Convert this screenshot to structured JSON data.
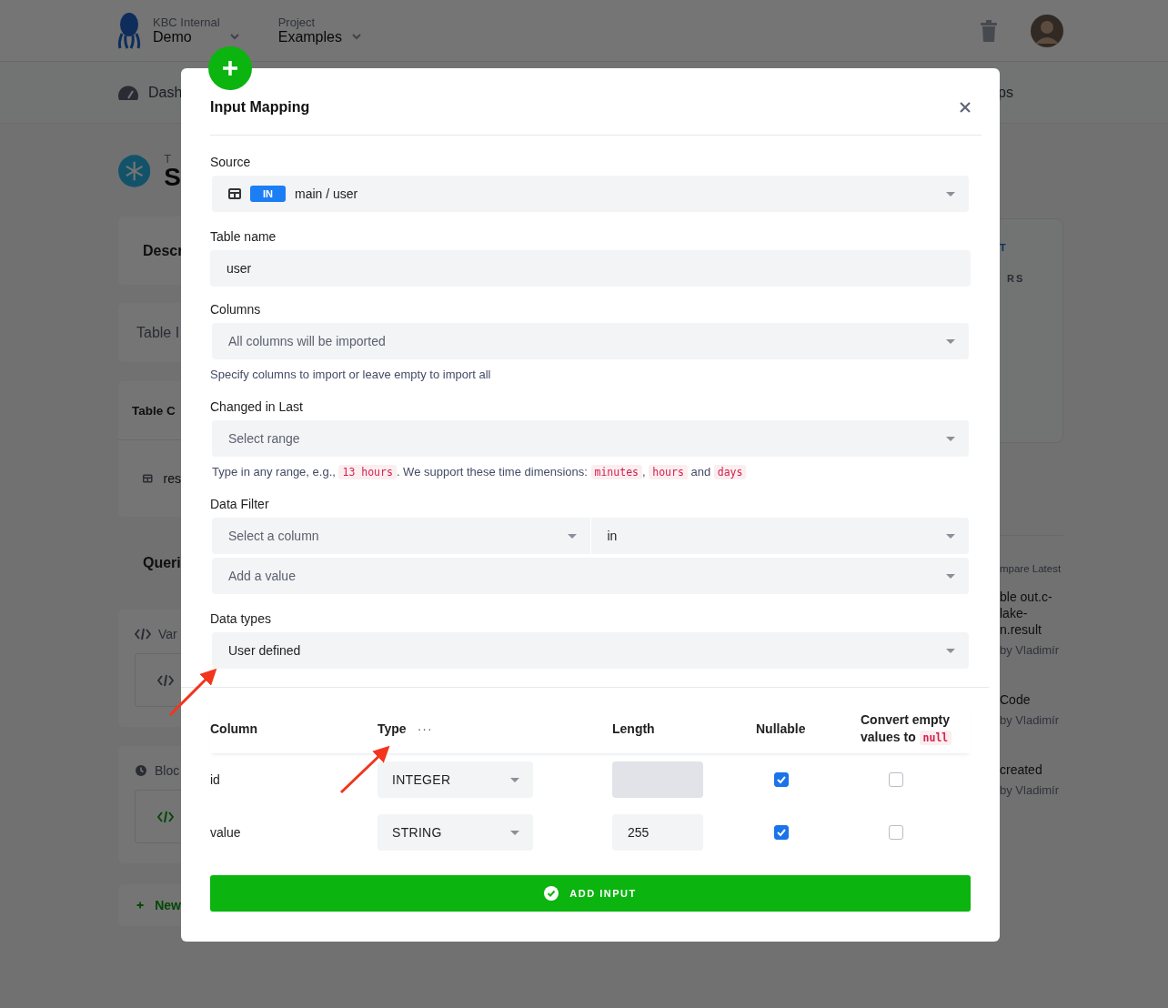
{
  "background_app": {
    "header": {
      "org_label": "KBC Internal",
      "org": "Demo",
      "project_label": "Project",
      "project": "Examples"
    },
    "nav": {
      "left": "Dash",
      "right": "ps"
    },
    "title": {
      "small": "T",
      "large": "S"
    },
    "left_fragments": [
      {
        "kind": "card-title",
        "text": "Descr"
      },
      {
        "kind": "card-muted",
        "text": "Table I"
      },
      {
        "kind": "card-table",
        "text": "Table C",
        "item": "res"
      },
      {
        "kind": "heading",
        "text": "Queri"
      },
      {
        "kind": "code-card",
        "text": "Var"
      },
      {
        "kind": "block-card",
        "text": "Bloc"
      },
      {
        "kind": "new",
        "text": "New"
      }
    ],
    "right_fragments": {
      "card_lines": [
        "T",
        "RS"
      ],
      "caption": "mpare Latest",
      "events": [
        {
          "lines": [
            "ble out.c-",
            "lake-",
            "n.result"
          ],
          "meta": "by Vladimír"
        },
        {
          "lines": [
            "Code"
          ],
          "meta": "by Vladimír"
        },
        {
          "lines": [
            "created"
          ],
          "meta": "by Vladimír"
        }
      ]
    }
  },
  "modal": {
    "title": "Input Mapping",
    "source": {
      "label": "Source",
      "badge": "IN",
      "value": "main / user"
    },
    "table_name": {
      "label": "Table name",
      "value": "user"
    },
    "columns": {
      "label": "Columns",
      "placeholder": "All columns will be imported",
      "help": "Specify columns to import or leave empty to import all"
    },
    "changed_in_last": {
      "label": "Changed in Last",
      "placeholder": "Select range",
      "help": [
        {
          "kind": "text",
          "text": "Type in any range, e.g., "
        },
        {
          "kind": "code",
          "text": "13 hours"
        },
        {
          "kind": "text",
          "text": ". We support these time dimensions: "
        },
        {
          "kind": "code",
          "text": "minutes"
        },
        {
          "kind": "text",
          "text": ", "
        },
        {
          "kind": "code",
          "text": "hours"
        },
        {
          "kind": "text",
          "text": " and "
        },
        {
          "kind": "code",
          "text": "days"
        }
      ]
    },
    "data_filter": {
      "label": "Data Filter",
      "column_placeholder": "Select a column",
      "operator": "in",
      "value_placeholder": "Add a value"
    },
    "data_types": {
      "label": "Data types",
      "value": "User defined"
    },
    "mapping_table": {
      "columns": [
        {
          "kind": "text",
          "text": "Column"
        },
        {
          "kind": "menu",
          "text": "Type",
          "menu": "···"
        },
        {
          "kind": "text",
          "text": "Length"
        },
        {
          "kind": "text",
          "text": "Nullable"
        },
        {
          "kind": "parts",
          "parts": [
            {
              "kind": "text",
              "text": "Convert empty values to "
            },
            {
              "kind": "code",
              "text": "null"
            }
          ]
        }
      ],
      "rows": [
        {
          "column": "id",
          "type": "INTEGER",
          "length_disabled": true,
          "nullable": true,
          "convert_empty_to_null": false
        },
        {
          "column": "value",
          "type": "STRING",
          "length": "255",
          "length_disabled": false,
          "nullable": true,
          "convert_empty_to_null": false
        }
      ]
    },
    "submit": "ADD INPUT"
  }
}
